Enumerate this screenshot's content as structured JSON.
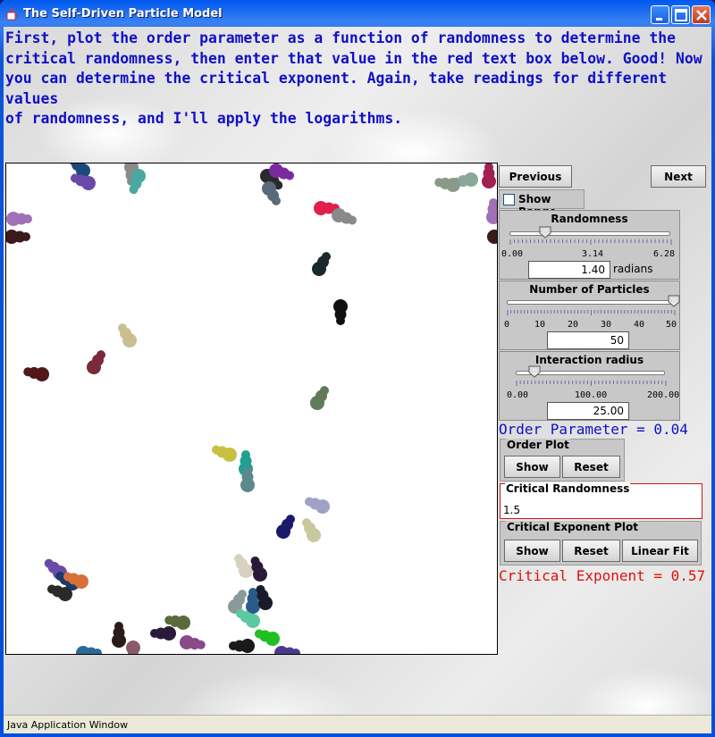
{
  "window": {
    "title": "The Self-Driven Particle Model",
    "icon": "java-cup-icon"
  },
  "instructions": [
    "First, plot the order parameter as a function of randomness to determine the",
    "critical randomness, then enter that value in the red text box below.  Good!  Now",
    "you can determine the critical exponent.  Again, take readings for different values",
    "of randomness, and I'll apply the logarithms."
  ],
  "nav": {
    "previous": "Previous",
    "next": "Next"
  },
  "show_range": {
    "label": "Show Range",
    "checked": false
  },
  "randomness": {
    "title": "Randomness",
    "ticks": [
      "0.00",
      "3.14",
      "6.28"
    ],
    "value": "1.40",
    "unit": "radians",
    "fraction": 0.223
  },
  "particles": {
    "title": "Number of Particles",
    "ticks": [
      "0",
      "10",
      "20",
      "30",
      "40",
      "50"
    ],
    "value": "50",
    "fraction": 1.0
  },
  "interaction": {
    "title": "Interaction radius",
    "ticks": [
      "0.00",
      "100.00",
      "200.00"
    ],
    "value": "25.00",
    "fraction": 0.125
  },
  "order_parameter": "Order Parameter = 0.04",
  "order_plot": {
    "title": "Order Plot",
    "show": "Show",
    "reset": "Reset"
  },
  "critical_randomness": {
    "title": "Critical Randomness",
    "value": "1.5"
  },
  "critical_exponent_plot": {
    "title": "Critical Exponent Plot",
    "show": "Show",
    "reset": "Reset",
    "linear_fit": "Linear Fit"
  },
  "critical_exponent": "Critical Exponent = 0.57",
  "status": "Java Application Window",
  "colors": {
    "instructions": "#1010c8",
    "critical_exponent": "#e01010",
    "critical_box_border": "#c81818"
  }
}
